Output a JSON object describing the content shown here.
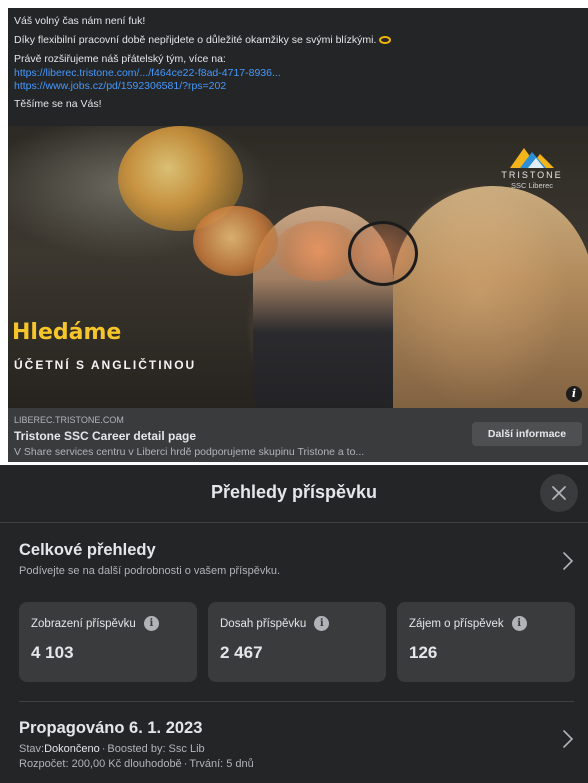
{
  "post": {
    "line1": "Váš volný čas nám není fuk!",
    "line2": "Díky flexibilní pracovní době nepřijdete o důležité okamžiky se svými blízkými.",
    "line3": "Právě rozšiřujeme náš přátelský tým, více na:",
    "link1": "https://liberec.tristone.com/.../f464ce22-f8ad-4717-8936...",
    "link2": "https://www.jobs.cz/pd/1592306581/?rps=202",
    "line4": "Těšíme se na Vás!"
  },
  "ad": {
    "logo_brand": "TRISTONE",
    "logo_sub": "SSC Liberec",
    "headline": "Hledáme",
    "subheadline": "ÚČETNÍ S ANGLIČTINOU",
    "domain": "LIBEREC.TRISTONE.COM",
    "link_title": "Tristone SSC Career detail page",
    "link_desc": "V Share services centru v Liberci hrdě podporujeme skupinu Tristone a to...",
    "cta_label": "Další informace"
  },
  "insights": {
    "title": "Přehledy příspěvku",
    "overall_title": "Celkové přehledy",
    "overall_sub": "Podívejte se na další podrobnosti o vašem příspěvku.",
    "metrics": [
      {
        "label": "Zobrazení příspěvku",
        "value": "4 103"
      },
      {
        "label": "Dosah příspěvku",
        "value": "2 467"
      },
      {
        "label": "Zájem o příspěvek",
        "value": "126"
      }
    ],
    "boost": {
      "title": "Propagováno 6. 1. 2023",
      "status_label": "Stav:",
      "status_value": "Dokončeno",
      "boosted_by": "Boosted by: Ssc Lib",
      "budget": "Rozpočet: 200,00 Kč dlouhodobě",
      "duration": "Trvání: 5 dnů"
    }
  },
  "icons": {
    "close": "close-icon",
    "chevron": "chevron-right-icon",
    "info": "info-icon"
  },
  "colors": {
    "panel_bg": "#242526",
    "card_bg": "#3a3b3c",
    "link_blue": "#4599ff",
    "headline_yellow": "#f6c52b"
  }
}
